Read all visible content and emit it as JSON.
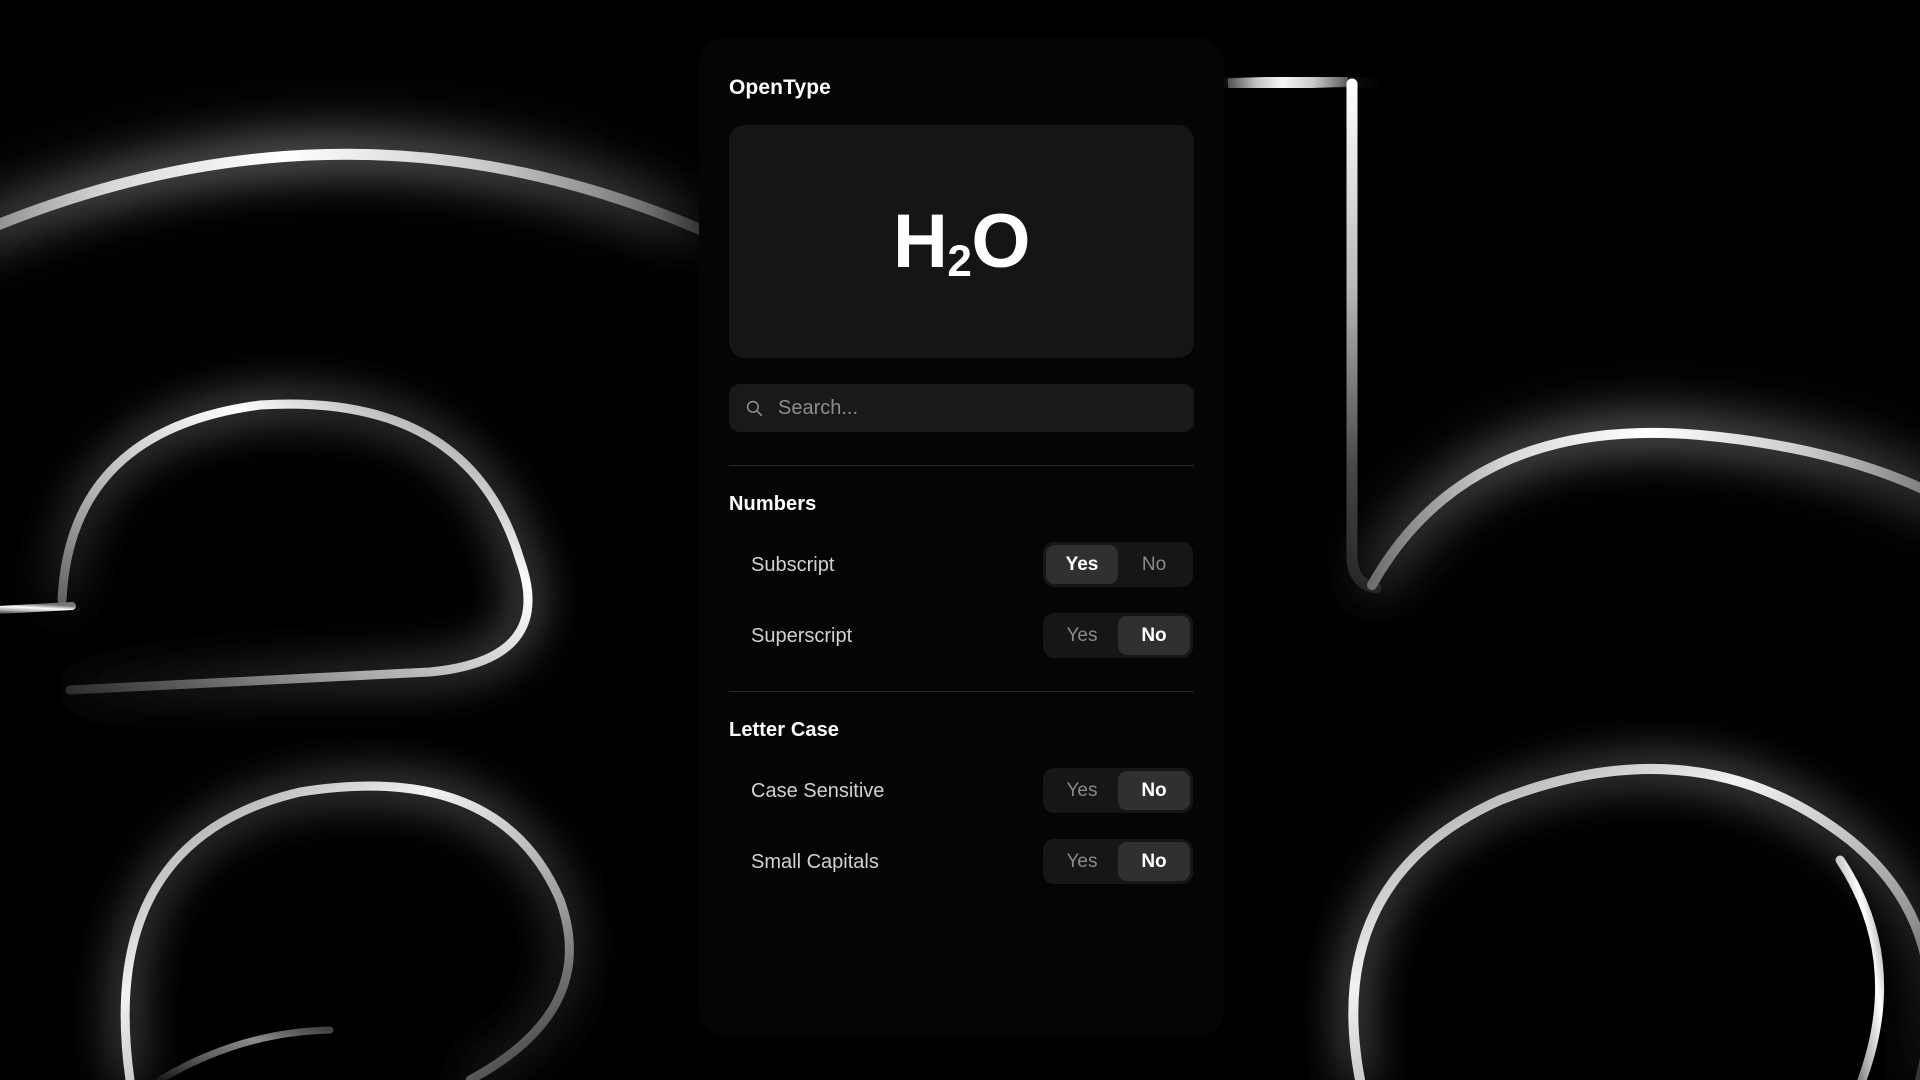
{
  "background": {
    "description": "large-glowing-letterform-outlines",
    "color": "#000000",
    "stroke_color": "#f2f2f2"
  },
  "panel": {
    "title": "OpenType",
    "background_color": "#050505"
  },
  "preview": {
    "base_text": "H",
    "subscript_text": "2",
    "trailing_text": "O",
    "background_color": "#151515",
    "text_color": "#ffffff"
  },
  "search": {
    "placeholder": "Search...",
    "value": "",
    "icon": "search-icon",
    "background_color": "#191919"
  },
  "sections": [
    {
      "title": "Numbers",
      "features": [
        {
          "label": "Subscript",
          "options": [
            "Yes",
            "No"
          ],
          "selected": "Yes"
        },
        {
          "label": "Superscript",
          "options": [
            "Yes",
            "No"
          ],
          "selected": "No"
        }
      ]
    },
    {
      "title": "Letter Case",
      "features": [
        {
          "label": "Case Sensitive",
          "options": [
            "Yes",
            "No"
          ],
          "selected": "No"
        },
        {
          "label": "Small Capitals",
          "options": [
            "Yes",
            "No"
          ],
          "selected": "No"
        }
      ]
    }
  ],
  "colors": {
    "selected_segment": "#303030",
    "segment_track": "#161616",
    "selected_text": "#ffffff",
    "unselected_text": "#8a8a8a",
    "divider": "#262626",
    "label_text": "#d2d2d2"
  }
}
